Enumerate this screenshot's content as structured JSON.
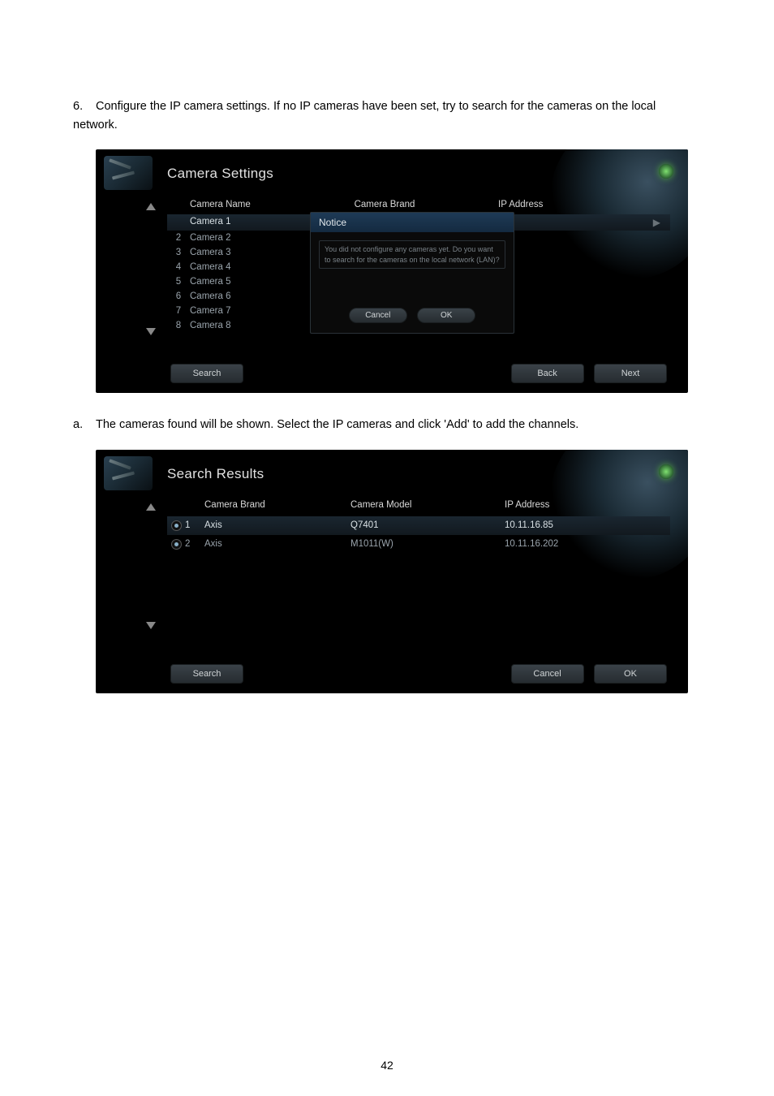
{
  "page_number": "42",
  "step6": {
    "number": "6.",
    "text": "Configure the IP camera settings.   If no IP cameras have been set, try to search for the cameras on the local network."
  },
  "camera_settings": {
    "title": "Camera Settings",
    "headers": {
      "name": "Camera Name",
      "brand": "Camera Brand",
      "ip": "IP Address"
    },
    "play_glyph": "▶",
    "rows": [
      {
        "idx": "",
        "name": "Camera 1",
        "selected": true
      },
      {
        "idx": "2",
        "name": "Camera 2"
      },
      {
        "idx": "3",
        "name": "Camera 3"
      },
      {
        "idx": "4",
        "name": "Camera 4"
      },
      {
        "idx": "5",
        "name": "Camera 5"
      },
      {
        "idx": "6",
        "name": "Camera 6"
      },
      {
        "idx": "7",
        "name": "Camera 7"
      },
      {
        "idx": "8",
        "name": "Camera 8"
      }
    ],
    "notice": {
      "title": "Notice",
      "message": "You did not configure any cameras yet. Do you want to search for the cameras on the local network (LAN)?",
      "cancel": "Cancel",
      "ok": "OK"
    },
    "search_btn": "Search",
    "back_btn": "Back",
    "next_btn": "Next"
  },
  "step_a": {
    "number": "a.",
    "text": "The cameras found will be shown.   Select the IP cameras and click 'Add' to add the channels."
  },
  "search_results": {
    "title": "Search Results",
    "headers": {
      "brand": "Camera Brand",
      "model": "Camera Model",
      "ip": "IP Address"
    },
    "rows": [
      {
        "idx": "1",
        "brand": "Axis",
        "model": "Q7401",
        "ip": "10.11.16.85",
        "selected": true,
        "checked": true
      },
      {
        "idx": "2",
        "brand": "Axis",
        "model": "M1011(W)",
        "ip": "10.11.16.202",
        "selected": false,
        "checked": true
      }
    ],
    "search_btn": "Search",
    "cancel_btn": "Cancel",
    "ok_btn": "OK"
  }
}
